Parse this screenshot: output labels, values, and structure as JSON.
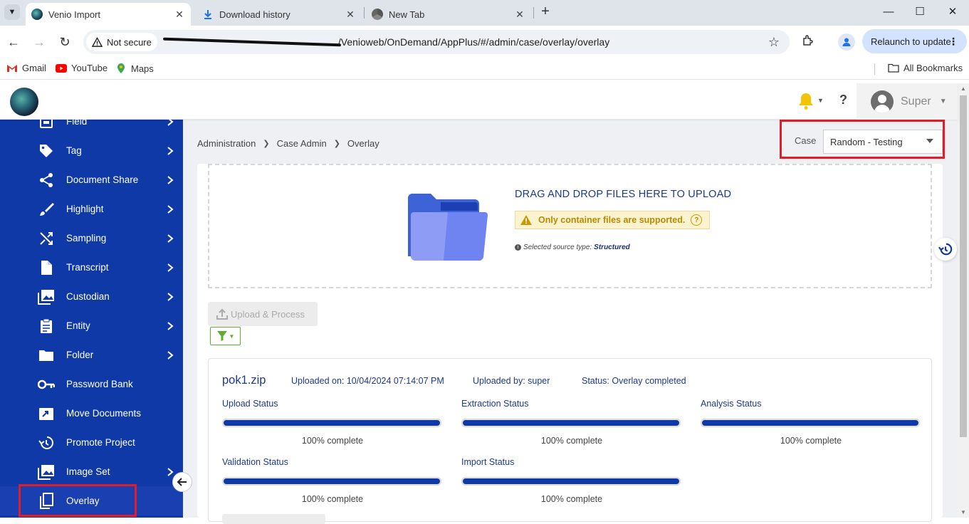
{
  "browser": {
    "tabs": [
      {
        "title": "Venio Import",
        "active": true,
        "icon": "venio-favicon"
      },
      {
        "title": "Download history",
        "active": false,
        "icon": "download-icon"
      },
      {
        "title": "New Tab",
        "active": false,
        "icon": "chrome-icon"
      }
    ],
    "security_label": "Not secure",
    "url": "/Venioweb/OnDemand/AppPlus/#/admin/case/overlay/overlay",
    "relaunch_label": "Relaunch to update",
    "bookmarks": [
      {
        "label": "Gmail",
        "icon": "gmail-icon"
      },
      {
        "label": "YouTube",
        "icon": "youtube-icon"
      },
      {
        "label": "Maps",
        "icon": "maps-icon"
      }
    ],
    "all_bookmarks": "All Bookmarks"
  },
  "header": {
    "user_name": "Super"
  },
  "sidebar": {
    "items": [
      {
        "label": "Field",
        "icon": "field-icon",
        "has_children": true
      },
      {
        "label": "Tag",
        "icon": "tag-icon",
        "has_children": true
      },
      {
        "label": "Document Share",
        "icon": "share-icon",
        "has_children": true
      },
      {
        "label": "Highlight",
        "icon": "brush-icon",
        "has_children": true
      },
      {
        "label": "Sampling",
        "icon": "shuffle-icon",
        "has_children": true
      },
      {
        "label": "Transcript",
        "icon": "file-icon",
        "has_children": true
      },
      {
        "label": "Custodian",
        "icon": "image-stack-icon",
        "has_children": true
      },
      {
        "label": "Entity",
        "icon": "clipboard-icon",
        "has_children": true
      },
      {
        "label": "Folder",
        "icon": "folder-icon",
        "has_children": true
      },
      {
        "label": "Password Bank",
        "icon": "key-icon",
        "has_children": false
      },
      {
        "label": "Move Documents",
        "icon": "move-icon",
        "has_children": false
      },
      {
        "label": "Promote Project",
        "icon": "history-icon",
        "has_children": false
      },
      {
        "label": "Image Set",
        "icon": "image-stack-icon",
        "has_children": true
      },
      {
        "label": "Overlay",
        "icon": "copy-icon",
        "has_children": false,
        "active": true
      }
    ]
  },
  "breadcrumb": [
    "Administration",
    "Case Admin",
    "Overlay"
  ],
  "case": {
    "label": "Case",
    "selected": "Random - Testing"
  },
  "dropzone": {
    "title": "DRAG AND DROP FILES HERE TO UPLOAD",
    "warning": "Only container files are supported.",
    "source_label": "Selected source type:",
    "source_value": "Structured"
  },
  "actions": {
    "upload_label": "Upload & Process"
  },
  "job": {
    "name": "pok1.zip",
    "uploaded_on_label": "Uploaded on:",
    "uploaded_on": "10/04/2024 07:14:07 PM",
    "uploaded_by_label": "Uploaded by:",
    "uploaded_by": "super",
    "status_label": "Status:",
    "status": "Overlay completed",
    "stages": [
      {
        "label": "Upload Status",
        "percent": 100,
        "text": "100% complete"
      },
      {
        "label": "Extraction Status",
        "percent": 100,
        "text": "100% complete"
      },
      {
        "label": "Analysis Status",
        "percent": 100,
        "text": "100% complete"
      },
      {
        "label": "Validation Status",
        "percent": 100,
        "text": "100% complete"
      },
      {
        "label": "Import Status",
        "percent": 100,
        "text": "100% complete"
      }
    ]
  },
  "colors": {
    "sidebar": "#0e39a6",
    "accent_text": "#1c3a8a",
    "highlight_red": "#e11d2a",
    "bell": "#f5c400",
    "filter_green": "#5fae2b"
  }
}
